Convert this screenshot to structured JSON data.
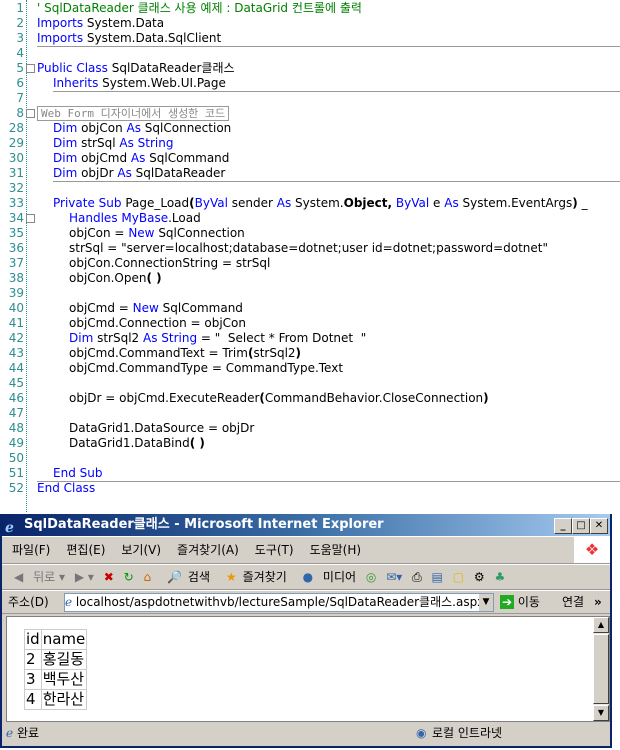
{
  "code": {
    "lines": [
      {
        "n": "1",
        "i": 0,
        "s": [
          [
            "' SqlDataReader 클래스 사용 예제 : DataGrid 컨트롤에 출력",
            "c"
          ]
        ]
      },
      {
        "n": "2",
        "i": 0,
        "s": [
          [
            "Imports",
            "k"
          ],
          [
            " System.Data",
            "n"
          ]
        ]
      },
      {
        "n": "3",
        "i": 0,
        "s": [
          [
            "Imports",
            "k"
          ],
          [
            " System.Data.SqlClient",
            "n"
          ]
        ]
      },
      {
        "n": "4",
        "i": 0,
        "s": []
      },
      {
        "n": "5",
        "i": 0,
        "s": [
          [
            "Public Class",
            "k"
          ],
          [
            " SqlDataReader클래스",
            "n"
          ]
        ]
      },
      {
        "n": "6",
        "i": 1,
        "s": [
          [
            "Inherits",
            "k"
          ],
          [
            " System.Web.UI.Page",
            "n"
          ]
        ]
      },
      {
        "n": "7",
        "i": 0,
        "s": []
      },
      {
        "n": "8",
        "i": 0,
        "s": [
          [
            "Web Form 디자이너에서 생성한 코드",
            "r"
          ]
        ]
      },
      {
        "n": "28",
        "i": 1,
        "s": [
          [
            "Dim",
            "k"
          ],
          [
            " objCon ",
            "n"
          ],
          [
            "As",
            "k"
          ],
          [
            " SqlConnection",
            "n"
          ]
        ]
      },
      {
        "n": "29",
        "i": 1,
        "s": [
          [
            "Dim",
            "k"
          ],
          [
            " strSql ",
            "n"
          ],
          [
            "As String",
            "k"
          ]
        ]
      },
      {
        "n": "30",
        "i": 1,
        "s": [
          [
            "Dim",
            "k"
          ],
          [
            " objCmd ",
            "n"
          ],
          [
            "As",
            "k"
          ],
          [
            " SqlCommand",
            "n"
          ]
        ]
      },
      {
        "n": "31",
        "i": 1,
        "s": [
          [
            "Dim",
            "k"
          ],
          [
            " objDr ",
            "n"
          ],
          [
            "As",
            "k"
          ],
          [
            " SqlDataReader",
            "n"
          ]
        ]
      },
      {
        "n": "32",
        "i": 0,
        "s": []
      },
      {
        "n": "33",
        "i": 1,
        "s": [
          [
            "Private Sub",
            "k"
          ],
          [
            " Page_Load",
            "n"
          ],
          [
            "(",
            "b"
          ],
          [
            "ByVal",
            "k"
          ],
          [
            " sender ",
            "n"
          ],
          [
            "As",
            "k"
          ],
          [
            " System.",
            "n"
          ],
          [
            "Object,",
            "b"
          ],
          [
            " ",
            "n"
          ],
          [
            "ByVal",
            "k"
          ],
          [
            " e ",
            "n"
          ],
          [
            "As",
            "k"
          ],
          [
            " System.EventArgs",
            "n"
          ],
          [
            ")",
            "b"
          ],
          [
            " _",
            "n"
          ]
        ]
      },
      {
        "n": "34",
        "i": 2,
        "s": [
          [
            "Handles",
            "k"
          ],
          [
            " ",
            "n"
          ],
          [
            "MyBase",
            "k"
          ],
          [
            ".Load",
            "n"
          ]
        ]
      },
      {
        "n": "35",
        "i": 2,
        "s": [
          [
            "objCon = ",
            "n"
          ],
          [
            "New",
            "k"
          ],
          [
            " SqlConnection",
            "n"
          ]
        ]
      },
      {
        "n": "36",
        "i": 2,
        "s": [
          [
            "strSql = \"server=localhost;database=dotnet;user id=dotnet;password=dotnet\"",
            "n"
          ]
        ]
      },
      {
        "n": "37",
        "i": 2,
        "s": [
          [
            "objCon.ConnectionString = strSql",
            "n"
          ]
        ]
      },
      {
        "n": "38",
        "i": 2,
        "s": [
          [
            "objCon.Open",
            "n"
          ],
          [
            "( )",
            "b"
          ]
        ]
      },
      {
        "n": "39",
        "i": 0,
        "s": []
      },
      {
        "n": "40",
        "i": 2,
        "s": [
          [
            "objCmd = ",
            "n"
          ],
          [
            "New",
            "k"
          ],
          [
            " SqlCommand",
            "n"
          ]
        ]
      },
      {
        "n": "41",
        "i": 2,
        "s": [
          [
            "objCmd.Connection = objCon",
            "n"
          ]
        ]
      },
      {
        "n": "42",
        "i": 2,
        "s": [
          [
            "Dim",
            "k"
          ],
          [
            " strSql2 ",
            "n"
          ],
          [
            "As String",
            "k"
          ],
          [
            " = \"  Select * From Dotnet  \"",
            "n"
          ]
        ]
      },
      {
        "n": "43",
        "i": 2,
        "s": [
          [
            "objCmd.CommandText = Trim",
            "n"
          ],
          [
            "(",
            "b"
          ],
          [
            "strSql2",
            "n"
          ],
          [
            ")",
            "b"
          ]
        ]
      },
      {
        "n": "44",
        "i": 2,
        "s": [
          [
            "objCmd.CommandType = CommandType.Text",
            "n"
          ]
        ]
      },
      {
        "n": "45",
        "i": 0,
        "s": []
      },
      {
        "n": "46",
        "i": 2,
        "s": [
          [
            "objDr = objCmd.ExecuteReader",
            "n"
          ],
          [
            "(",
            "b"
          ],
          [
            "CommandBehavior.CloseConnection",
            "n"
          ],
          [
            ")",
            "b"
          ]
        ]
      },
      {
        "n": "47",
        "i": 0,
        "s": []
      },
      {
        "n": "48",
        "i": 2,
        "s": [
          [
            "DataGrid1.DataSource = objDr",
            "n"
          ]
        ]
      },
      {
        "n": "49",
        "i": 2,
        "s": [
          [
            "DataGrid1.DataBind",
            "n"
          ],
          [
            "( )",
            "b"
          ]
        ]
      },
      {
        "n": "50",
        "i": 0,
        "s": []
      },
      {
        "n": "51",
        "i": 1,
        "s": [
          [
            "End Sub",
            "k"
          ]
        ]
      },
      {
        "n": "52",
        "i": 0,
        "s": [
          [
            "End Class",
            "k"
          ]
        ]
      }
    ]
  },
  "ie": {
    "title": "SqlDataReader클래스 - Microsoft Internet Explorer",
    "menu": [
      "파일(F)",
      "편집(E)",
      "보기(V)",
      "즐겨찾기(A)",
      "도구(T)",
      "도움말(H)"
    ],
    "toolbar": {
      "back": "뒤로",
      "search": "검색",
      "favorites": "즐겨찾기",
      "media": "미디어"
    },
    "address_label": "주소(D)",
    "address": "localhost/aspdotnetwithvb/lectureSample/SqlDataReader클래스.aspx",
    "go": "이동",
    "links": "연결",
    "more": "»",
    "grid": {
      "headers": [
        "id",
        "name"
      ],
      "rows": [
        [
          "2",
          "홍길동"
        ],
        [
          "3",
          "백두산"
        ],
        [
          "4",
          "한라산"
        ]
      ]
    },
    "status": "완료",
    "zone": "로컬 인트라넷"
  }
}
